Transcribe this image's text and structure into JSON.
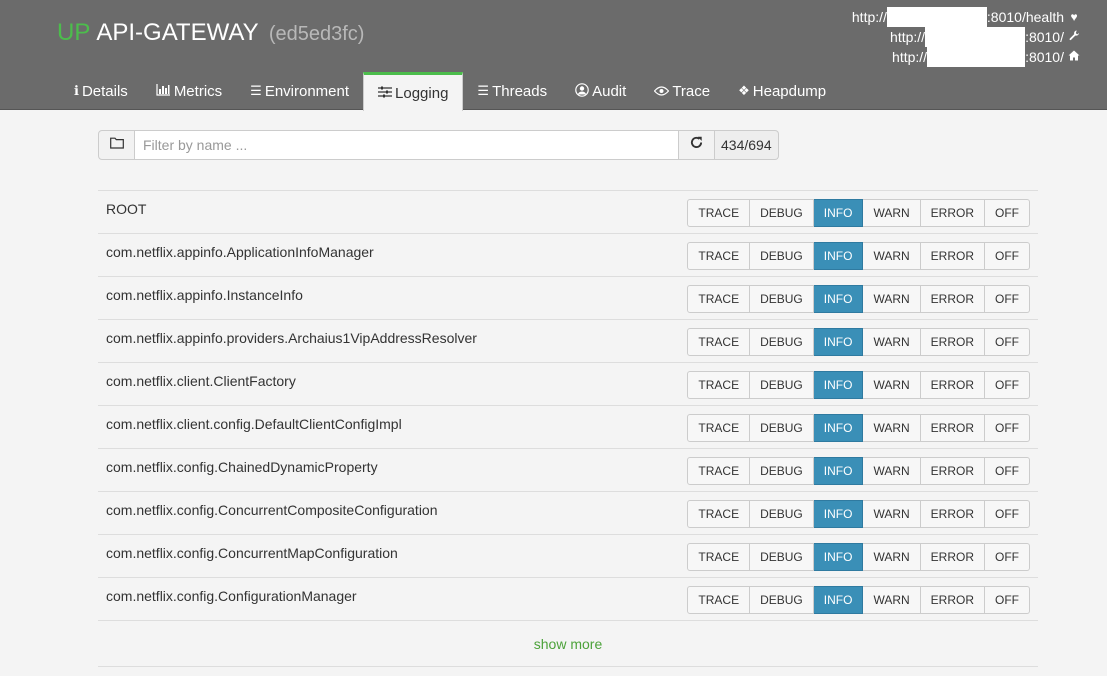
{
  "header": {
    "status": "UP",
    "app_name": "API-GATEWAY",
    "app_id": "(ed5ed3fc)",
    "urls": [
      {
        "prefix": "http://",
        "suffix": ":8010/health",
        "icon": "heartbeat-icon",
        "glyph": "♥"
      },
      {
        "prefix": "http://",
        "suffix": ":8010/",
        "icon": "wrench-icon",
        "glyph": "🔧"
      },
      {
        "prefix": "http://",
        "suffix": ":8010/",
        "icon": "home-icon",
        "glyph": "⌂"
      }
    ]
  },
  "tabs": [
    {
      "key": "details",
      "label": "Details",
      "icon": "info-icon",
      "glyph": "ℹ"
    },
    {
      "key": "metrics",
      "label": "Metrics",
      "icon": "bar-chart-icon",
      "glyph": "▥"
    },
    {
      "key": "environment",
      "label": "Environment",
      "icon": "list-icon",
      "glyph": "☰"
    },
    {
      "key": "logging",
      "label": "Logging",
      "icon": "sliders-icon",
      "glyph": "☷",
      "active": true
    },
    {
      "key": "threads",
      "label": "Threads",
      "icon": "list-icon",
      "glyph": "☰"
    },
    {
      "key": "audit",
      "label": "Audit",
      "icon": "user-icon",
      "glyph": "◉"
    },
    {
      "key": "trace",
      "label": "Trace",
      "icon": "eye-icon",
      "glyph": "◉"
    },
    {
      "key": "heapdump",
      "label": "Heapdump",
      "icon": "cubes-icon",
      "glyph": "❖"
    }
  ],
  "filter": {
    "placeholder": "Filter by name ...",
    "value": "",
    "count": "434/694"
  },
  "levels": [
    "TRACE",
    "DEBUG",
    "INFO",
    "WARN",
    "ERROR",
    "OFF"
  ],
  "loggers": [
    {
      "name": "ROOT",
      "level": "INFO"
    },
    {
      "name": "com.netflix.appinfo.ApplicationInfoManager",
      "level": "INFO"
    },
    {
      "name": "com.netflix.appinfo.InstanceInfo",
      "level": "INFO"
    },
    {
      "name": "com.netflix.appinfo.providers.Archaius1VipAddressResolver",
      "level": "INFO"
    },
    {
      "name": "com.netflix.client.ClientFactory",
      "level": "INFO"
    },
    {
      "name": "com.netflix.client.config.DefaultClientConfigImpl",
      "level": "INFO"
    },
    {
      "name": "com.netflix.config.ChainedDynamicProperty",
      "level": "INFO"
    },
    {
      "name": "com.netflix.config.ConcurrentCompositeConfiguration",
      "level": "INFO"
    },
    {
      "name": "com.netflix.config.ConcurrentMapConfiguration",
      "level": "INFO"
    },
    {
      "name": "com.netflix.config.ConfigurationManager",
      "level": "INFO"
    }
  ],
  "show_more_label": "show more",
  "colors": {
    "header_bg": "#6b6b6b",
    "status_up": "#4cbd4c",
    "active_level": "#3a8fb7",
    "link": "#4ca23a"
  }
}
